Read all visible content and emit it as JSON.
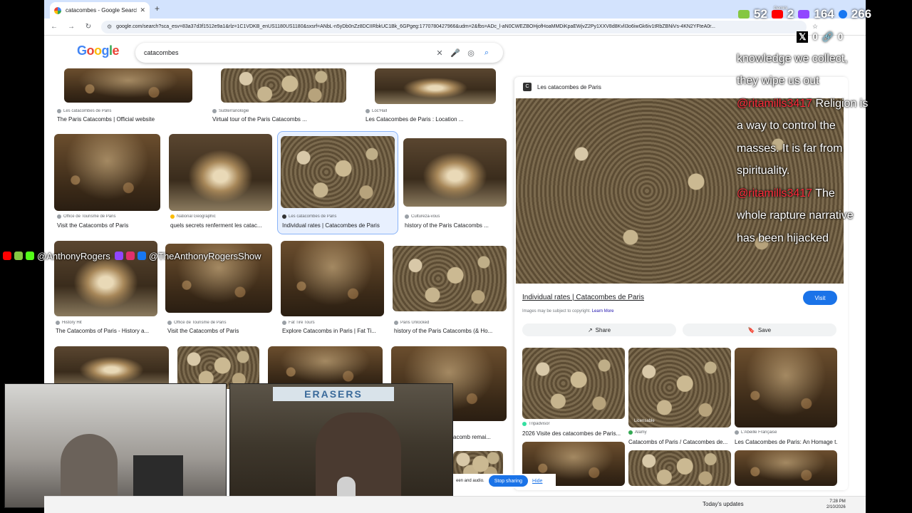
{
  "browser": {
    "tab_title": "catacombes - Google Search",
    "url": "google.com/search?sca_esv=83a37d3f1512e9a1&rlz=1C1VDKB_enUS1180US1180&sxsrf=ANbL-n5yDb0nZz8DCIIRbkUC1Bk_6GPgeg:1770780427966&udm=2&fbs=ADc_l-aN0CWEZBOHjofHoaMMDiKpaEWjvZ2Py1XXV8d8KvlI3o6iwGk6iv1tRbZBNiVs-4KN2YFteA0r..."
  },
  "search": {
    "logo": "Google",
    "query": "catacombes"
  },
  "results": [
    {
      "source": "Les catacombes de Paris",
      "title": "The Paris Catacombs | Official website"
    },
    {
      "source": "Subterranologie",
      "title": "Virtual tour of the Paris Catacombs ..."
    },
    {
      "source": "Loc'Hall",
      "title": "Les Catacombes de Paris : Location ..."
    },
    {
      "source": "Office de Tourisme de Paris",
      "title": "Visit the Catacombs of Paris"
    },
    {
      "source": "National Geographic",
      "title": "quels secrets renferment les catac..."
    },
    {
      "source": "Les catacombes de Paris",
      "title": "Individual rates | Catacombes de Paris"
    },
    {
      "source": "Cultureza-vous",
      "title": "history of the Paris Catacombs ..."
    },
    {
      "source": "History Hit",
      "title": "The Catacombs of Paris - History a..."
    },
    {
      "source": "Office de Tourisme de Paris",
      "title": "Visit the Catacombs of Paris"
    },
    {
      "source": "Fat Tire Tours",
      "title": "Explore Catacombs in Paris | Fat Ti..."
    },
    {
      "source": "Paris Unlocked",
      "title": "history of the Paris Catacombs (& Ho..."
    },
    {
      "source": "",
      "title": "acomb remai..."
    }
  ],
  "panel": {
    "site": "Les catacombes de Paris",
    "title": "Individual rates | Catacombes de Paris",
    "visit": "Visit",
    "copyright": "Images may be subject to copyright.",
    "learn_more": "Learn More",
    "share": "Share",
    "save": "Save",
    "related": [
      {
        "badge": "",
        "source": "Tripadvisor",
        "title": "2026 Visite des catacombes de Paris..."
      },
      {
        "badge": "Licensable",
        "source": "Alamy",
        "title": "Catacombs of Paris / Catacombes de..."
      },
      {
        "badge": "",
        "source": "L'Abeille Française",
        "title": "Les Catacombes de Paris: An Homage t..."
      }
    ]
  },
  "stream": {
    "stats": {
      "rumble": "52",
      "youtube": "2",
      "twitch": "164",
      "facebook": "266",
      "x": "0",
      "link": "0"
    },
    "gemini": "Gemini",
    "chat": [
      {
        "user": "",
        "text": "knowledge we collect,"
      },
      {
        "user": "",
        "text": "they wipe us out"
      },
      {
        "user": "@ritamills3417",
        "text": "Religion is"
      },
      {
        "user": "",
        "text": "a way to control the"
      },
      {
        "user": "",
        "text": "masses. It is far from"
      },
      {
        "user": "",
        "text": "spirituality."
      },
      {
        "user": "@ritamills3417",
        "text": "The"
      },
      {
        "user": "",
        "text": "whole rapture narrative"
      },
      {
        "user": "",
        "text": "has been hijacked"
      }
    ],
    "handle1": "@AnthonyRogers",
    "handle2": "@TheAnthonyRogersShow",
    "cam_label": "ERASERS"
  },
  "share_bar": {
    "text": "een and audio.",
    "stop": "Stop sharing",
    "hide": "Hide"
  },
  "taskbar": {
    "updates": "Today's updates",
    "time": "7:28 PM",
    "date": "2/10/2026"
  }
}
